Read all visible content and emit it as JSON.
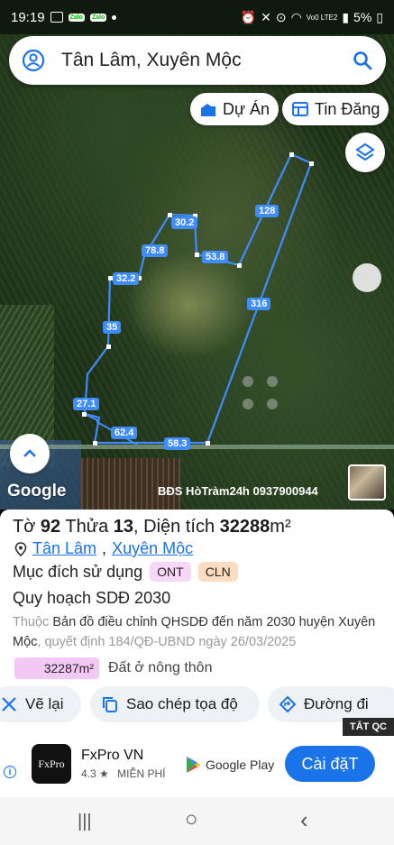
{
  "status_bar": {
    "time": "19:19",
    "app_tags": [
      "Zalo",
      "Zalo"
    ],
    "battery": "5%",
    "network": "Vo0 LTE2"
  },
  "search": {
    "value": "Tân Lâm, Xuyên Mộc",
    "profile_icon": "account-circle-icon",
    "search_icon": "search-icon"
  },
  "chips": {
    "du_an": "Dự Án",
    "tin_dang": "Tin Đăng"
  },
  "map": {
    "edge_labels": [
      "128",
      "30.2",
      "78.8",
      "53.8",
      "32.2",
      "316",
      "35",
      "27.1",
      "62.4",
      "58.3"
    ],
    "google_label": "Google",
    "watermark": "BĐS HòTràm24h 0937900944",
    "plot_color": "#4a90ff"
  },
  "parcel": {
    "prefix_to": "Tờ",
    "to_number": "92",
    "prefix_thua": "Thửa",
    "thua_number": "13",
    "area_prefix": "Diện tích",
    "area_value": "32288",
    "area_unit": "m²",
    "location_link_1": "Tân Lâm",
    "location_sep": ",",
    "location_link_2": "Xuyên Mộc",
    "purpose_label": "Mục đích sử dụng",
    "purpose_badges": [
      "ONT",
      "CLN"
    ],
    "plan_label": "Quy hoạch SDĐ 2030",
    "desc_grey_1": "Thuộc",
    "desc_main": "Bản đồ điều chỉnh QHSDĐ đến năm 2030 huyện Xuyên Mộc",
    "desc_grey_2": ", quyết định 184/QĐ-UBND ngày 26/03/2025",
    "sub_area": "32287m²",
    "sub_area_label": "Đất ở nông thôn"
  },
  "actions": {
    "ve_lai": "Vẽ lại",
    "sao_chep": "Sao chép tọa độ",
    "duong_di": "Đường đi"
  },
  "ad": {
    "close_label": "TẮT QC",
    "app_name": "FxPro VN",
    "logo_text": "FxPro",
    "rating": "4.3 ★",
    "price": "MIỄN PHÍ",
    "store": "Google Play",
    "install": "Cài đặT"
  },
  "navbar": {
    "recent": "|||",
    "home": "○",
    "back": "‹"
  }
}
